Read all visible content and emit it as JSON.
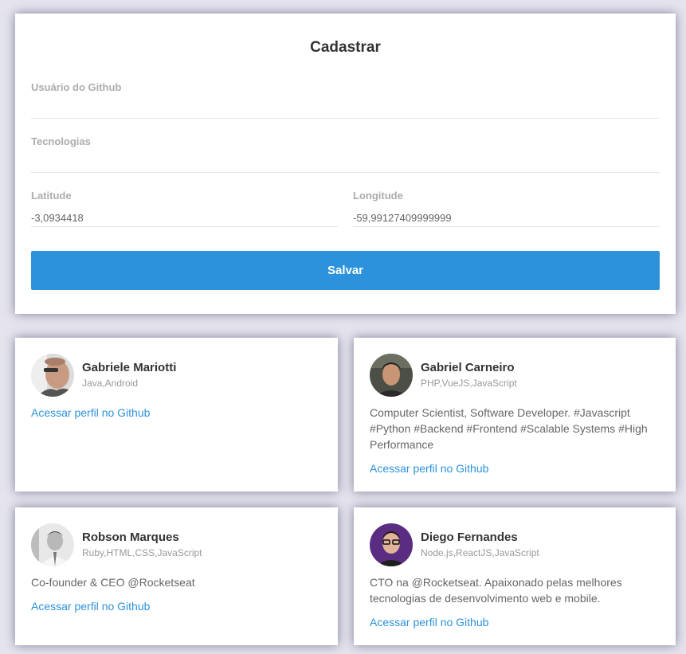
{
  "form": {
    "title": "Cadastrar",
    "github_user": {
      "label": "Usuário do Github",
      "value": ""
    },
    "techs": {
      "label": "Tecnologias",
      "value": ""
    },
    "latitude": {
      "label": "Latitude",
      "value": "-3,0934418"
    },
    "longitude": {
      "label": "Longitude",
      "value": "-59,99127409999999"
    },
    "save_label": "Salvar"
  },
  "devs": [
    {
      "name": "Gabriele Mariotti",
      "techs": "Java,Android",
      "bio": "",
      "link": "Acessar perfil no Github"
    },
    {
      "name": "Gabriel Carneiro",
      "techs": "PHP,VueJS,JavaScript",
      "bio": "Computer Scientist, Software Developer. #Javascript #Python #Backend #Frontend #Scalable Systems #High Performance",
      "link": "Acessar perfil no Github"
    },
    {
      "name": "Robson Marques",
      "techs": "Ruby,HTML,CSS,JavaScript",
      "bio": "Co-founder & CEO @Rocketseat",
      "link": "Acessar perfil no Github"
    },
    {
      "name": "Diego Fernandes",
      "techs": "Node.js,ReactJS,JavaScript",
      "bio": "CTO na @Rocketseat. Apaixonado pelas melhores tecnologias de desenvolvimento web e mobile.",
      "link": "Acessar perfil no Github"
    }
  ],
  "colors": {
    "accent": "#2c92dc",
    "background": "#e4e3ee"
  }
}
